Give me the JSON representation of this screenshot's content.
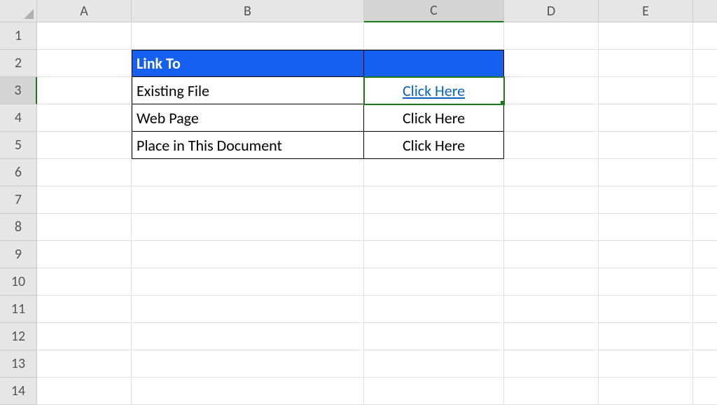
{
  "columns": [
    "A",
    "B",
    "C",
    "D",
    "E",
    ""
  ],
  "rows": [
    "1",
    "2",
    "3",
    "4",
    "5",
    "6",
    "7",
    "8",
    "9",
    "10",
    "11",
    "12",
    "13",
    "14"
  ],
  "active_column": "C",
  "active_row": "3",
  "selected_cell": "C3",
  "table": {
    "header": {
      "b": "Link To",
      "c": ""
    },
    "data": [
      {
        "b": "Existing File",
        "c": "Click Here",
        "c_is_link": true
      },
      {
        "b": "Web Page",
        "c": "Click Here",
        "c_is_link": false
      },
      {
        "b": "Place in This Document",
        "c": "Click Here",
        "c_is_link": false
      }
    ]
  },
  "colors": {
    "header_bg": "#1560f0",
    "header_fg": "#ffffff",
    "hyperlink": "#0563c1",
    "selection": "#1a7a1a"
  }
}
